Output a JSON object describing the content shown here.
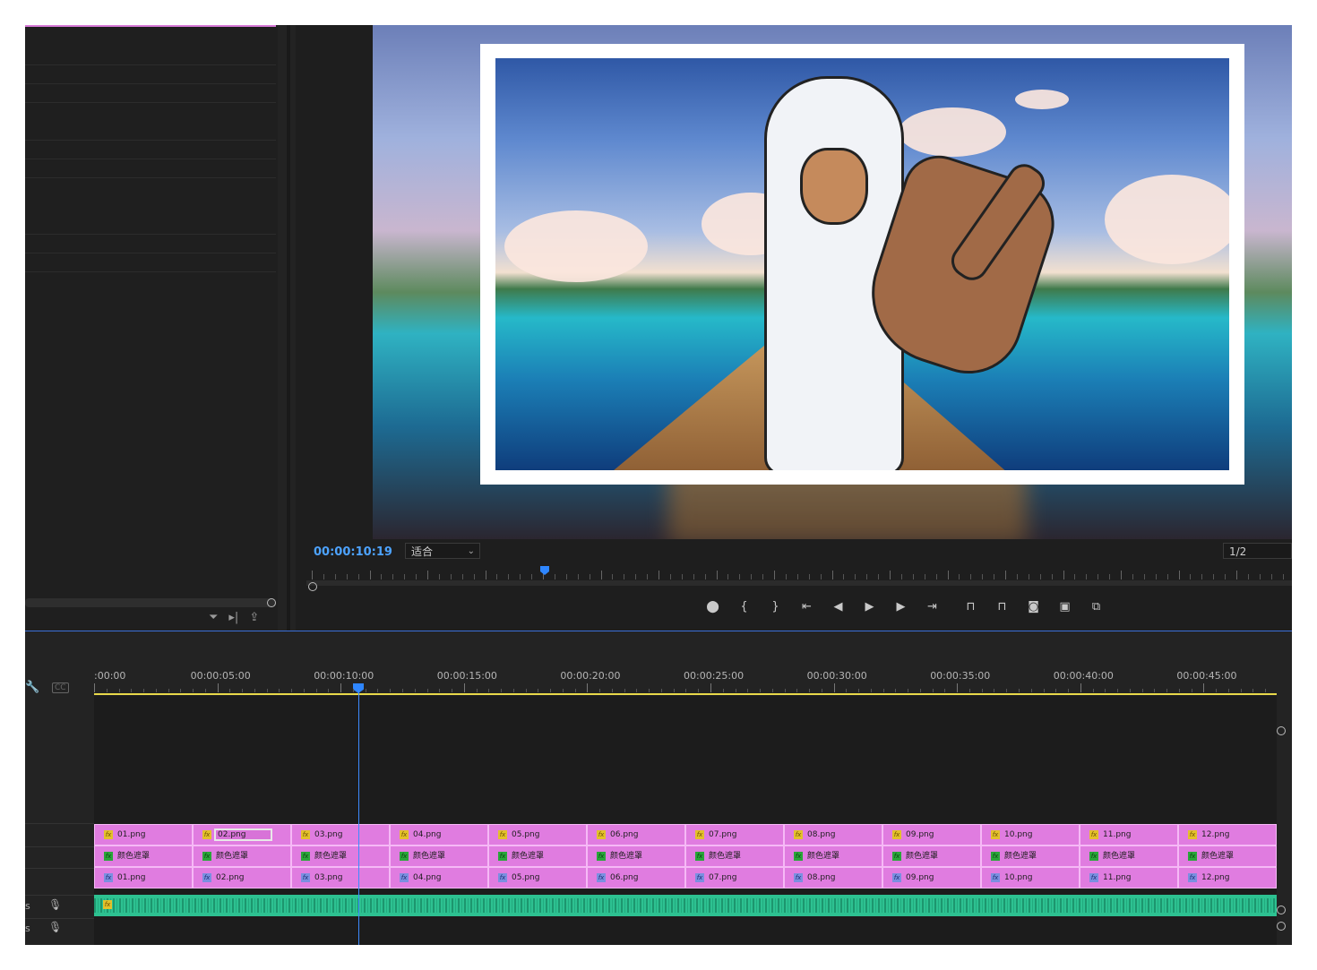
{
  "monitor": {
    "timecode": "00:00:10:19",
    "fit_label": "适合",
    "resolution": "1/2",
    "controls": [
      {
        "name": "marker-icon",
        "glyph": "⬤"
      },
      {
        "name": "mark-in-icon",
        "glyph": "{"
      },
      {
        "name": "mark-out-icon",
        "glyph": "}"
      },
      {
        "name": "go-to-in-icon",
        "glyph": "⇤"
      },
      {
        "name": "step-back-icon",
        "glyph": "◀"
      },
      {
        "name": "play-icon",
        "glyph": "▶"
      },
      {
        "name": "step-forward-icon",
        "glyph": "▶"
      },
      {
        "name": "go-to-out-icon",
        "glyph": "⇥"
      },
      {
        "name": "lift-icon",
        "glyph": "⊓"
      },
      {
        "name": "extract-icon",
        "glyph": "⊓"
      },
      {
        "name": "export-frame-icon",
        "glyph": "◙"
      },
      {
        "name": "insert-icon",
        "glyph": "▣"
      },
      {
        "name": "overwrite-icon",
        "glyph": "⧉"
      }
    ]
  },
  "timeline": {
    "ruler_labels": [
      ":00:00",
      "00:00:05:00",
      "00:00:10:00",
      "00:00:15:00",
      "00:00:20:00",
      "00:00:25:00",
      "00:00:30:00",
      "00:00:35:00",
      "00:00:40:00",
      "00:00:45:00"
    ],
    "fx_label": "fx",
    "v3": [
      "01.png",
      "02.png",
      "03.png",
      "04.png",
      "05.png",
      "06.png",
      "07.png",
      "08.png",
      "09.png",
      "10.png",
      "11.png",
      "12.png"
    ],
    "v2": [
      "颜色遮罩",
      "颜色遮罩",
      "颜色遮罩",
      "颜色遮罩",
      "颜色遮罩",
      "颜色遮罩",
      "颜色遮罩",
      "颜色遮罩",
      "颜色遮罩",
      "颜色遮罩",
      "颜色遮罩",
      "颜色遮罩"
    ],
    "v1": [
      "01.png",
      "02.png",
      "03.png",
      "04.png",
      "05.png",
      "06.png",
      "07.png",
      "08.png",
      "09.png",
      "10.png",
      "11.png",
      "12.png"
    ],
    "track_s_label": "s",
    "selected_clip": "02.png",
    "colors": {
      "clip": "#e07ce0",
      "audio": "#2dc191",
      "playhead": "#2e86ff",
      "work_area": "#e8d94a"
    }
  }
}
